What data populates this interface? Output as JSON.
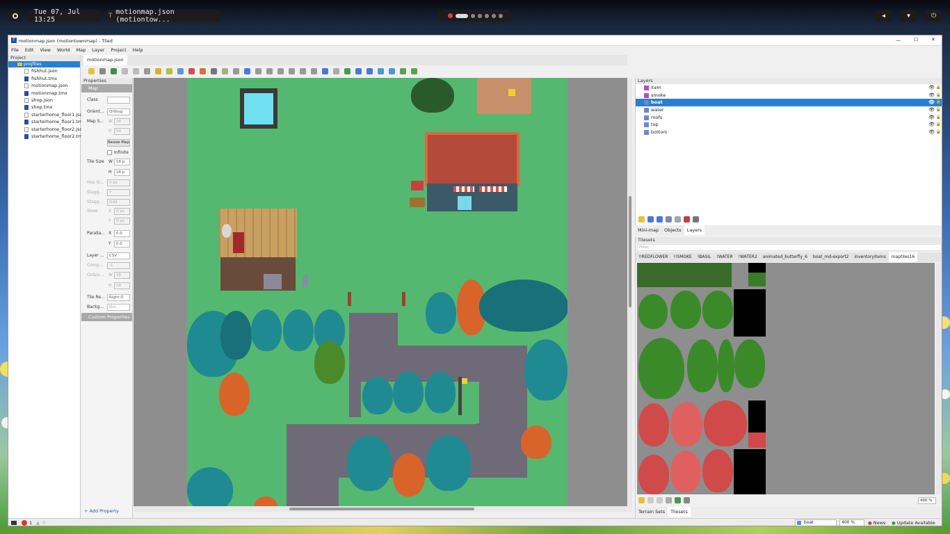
{
  "topbar": {
    "datetime": "Tue 07, Jul 13:25",
    "active_window": "motionmap.json (motiontow...",
    "app_icon": "tiled-icon",
    "power_icon": "power-icon",
    "volume_icon": "volume-icon",
    "wifi_icon": "wifi-icon"
  },
  "window": {
    "title": "motionmap.json (motiontownmap) - Tiled",
    "controls": {
      "minimize": "—",
      "maximize": "☐",
      "close": "✕"
    }
  },
  "menu": [
    "File",
    "Edit",
    "View",
    "World",
    "Map",
    "Layer",
    "Project",
    "Help"
  ],
  "project": {
    "header": "Project",
    "root": "projfiles",
    "files": [
      "fishhut.json",
      "fishhut.tmx",
      "motionmap.json",
      "motionmap.tmx",
      "shop.json",
      "shop.tmx",
      "starterhome_floor1.json",
      "starterhome_floor1.tmx",
      "starterhome_floor2.json",
      "starterhome_floor2.tmx"
    ]
  },
  "document_tab": "motionmap.json",
  "properties": {
    "header": "Properties",
    "section_map": "Map",
    "class_label": "Class",
    "orient_label": "Orient...",
    "orient_value": "Orthog",
    "mapsize_label": "Map S...",
    "w_label": "W",
    "h_label": "H",
    "map_w": "24",
    "map_h": "54",
    "resize_button": "Resize Map",
    "infinite_label": "Infinite",
    "tilesize_label": "Tile Size",
    "tile_w": "16 p",
    "tile_h": "16 p",
    "hexside_label": "Hex Si...",
    "hexside_value": "0 px",
    "stagg1_label": "Stagg...",
    "stagg1_value": "Y",
    "stagg2_label": "Stagg...",
    "stagg2_value": "Odd",
    "skew_label": "Skew",
    "x_label": "X",
    "y_label": "Y",
    "skew_x": "0 px",
    "skew_y": "0 px",
    "parallax_label": "Paralla...",
    "parallax_x": "0.0",
    "parallax_y": "0.0",
    "layerfmt_label": "Layer ...",
    "layerfmt_value": "CSV",
    "comp_label": "Comp...",
    "comp_value": "-1",
    "output_label": "Outpu...",
    "out_w": "16",
    "out_h": "16",
    "tilerender_label": "Tile Re...",
    "tilerender_value": "Right D",
    "background_label": "Backg...",
    "background_value": "Not...",
    "custom_section": "Custom Properties",
    "add_property": "Add Property"
  },
  "layers": {
    "header": "Layers",
    "items": [
      {
        "name": "item",
        "type": "object"
      },
      {
        "name": "smoke",
        "type": "object"
      },
      {
        "name": "boat",
        "type": "tile",
        "selected": true
      },
      {
        "name": "water",
        "type": "tile"
      },
      {
        "name": "roofs",
        "type": "tile"
      },
      {
        "name": "top",
        "type": "tile"
      },
      {
        "name": "bottom",
        "type": "tile"
      }
    ],
    "dock_tabs": [
      "Mini-map",
      "Objects",
      "Layers"
    ],
    "active_dock_tab": "Layers"
  },
  "tilesets": {
    "header": "Tilesets",
    "filter_placeholder": "Filter",
    "tabs": [
      "!!REDFLOWER",
      "!!SMOKE",
      "!BASIL",
      "!WATER",
      "!WATER2",
      "animated_butterfly_6",
      "boat_md-export2",
      "inventoryitems",
      "maptiles16"
    ],
    "active_tab": "maptiles16",
    "zoom": "400 %",
    "bottom_tabs": [
      "Terrain Sets",
      "Tilesets"
    ],
    "active_bottom_tab": "Tilesets"
  },
  "statusbar": {
    "errors": "1",
    "warnings": "0",
    "layer_select": "boat",
    "zoom": "400 %",
    "news": "News",
    "update": "Update Available"
  },
  "colors": {
    "grass": "#55b870",
    "path": "#6e6a78",
    "teal_tree": "#1f8a92",
    "orange_tree": "#d9642a",
    "selection": "#2a7fd0"
  }
}
